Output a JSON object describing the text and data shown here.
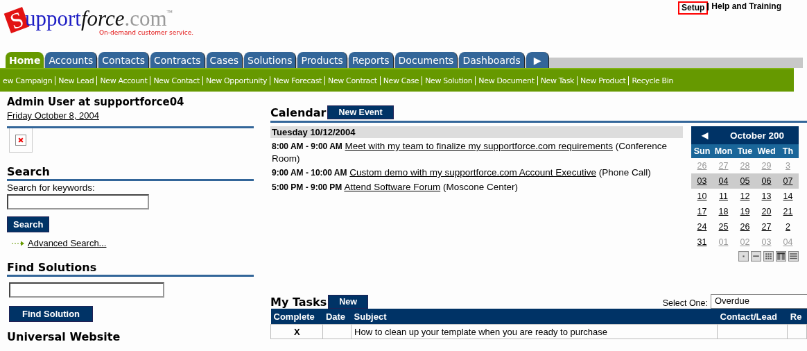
{
  "logo": {
    "initial": "S",
    "part1": "upport",
    "part2": "force",
    "part3": ".com",
    "tm": "™",
    "tagline": "On-demand customer service."
  },
  "top_links": [
    {
      "label": "Setup",
      "highlighted": true
    },
    {
      "label": "Help and Training",
      "highlighted": false
    }
  ],
  "tabs": [
    {
      "label": "Home",
      "selected": true,
      "kind": "text"
    },
    {
      "label": "Accounts",
      "selected": false,
      "kind": "text"
    },
    {
      "label": "Contacts",
      "selected": false,
      "kind": "text"
    },
    {
      "label": "Contracts",
      "selected": false,
      "kind": "text"
    },
    {
      "label": "Cases",
      "selected": false,
      "kind": "text"
    },
    {
      "label": "Solutions",
      "selected": false,
      "kind": "text"
    },
    {
      "label": "Products",
      "selected": false,
      "kind": "text"
    },
    {
      "label": "Reports",
      "selected": false,
      "kind": "text"
    },
    {
      "label": "Documents",
      "selected": false,
      "kind": "text"
    },
    {
      "label": "Dashboards",
      "selected": false,
      "kind": "text"
    },
    {
      "label": "▶",
      "selected": false,
      "kind": "more"
    }
  ],
  "quick_links": [
    "ew Campaign",
    "New Lead",
    "New Account",
    "New Contact",
    "New Opportunity",
    "New Forecast",
    "New Contract",
    "New Case",
    "New Solution",
    "New Document",
    "New Task",
    "New Product",
    "Recycle Bin"
  ],
  "user": {
    "title": "Admin User at supportforce04",
    "date": "Friday October 8, 2004"
  },
  "sidebar": {
    "search": {
      "heading": "Search",
      "label": "Search for keywords:",
      "button": "Search",
      "advanced": "Advanced Search..."
    },
    "solutions": {
      "heading": "Find Solutions",
      "button": "Find Solution"
    },
    "next_heading": "Universal Website"
  },
  "calendar": {
    "title": "Calendar",
    "button": "New Event",
    "day": "Tuesday 10/12/2004",
    "events": [
      {
        "time": "8:00 AM - 9:00 AM",
        "subject": "Meet with my team to finalize my supportforce.com requirements",
        "location": "(Conference Room)"
      },
      {
        "time": "9:00 AM - 10:00 AM",
        "subject": "Custom demo with my supportforce.com Account Executive",
        "location": "(Phone Call)"
      },
      {
        "time": "5:00 PM - 9:00 PM",
        "subject": "Attend Software Forum",
        "location": "(Moscone Center)"
      }
    ],
    "month": {
      "prev": "◀",
      "title": "October 200",
      "weekdays": [
        "Sun",
        "Mon",
        "Tue",
        "Wed",
        "Th"
      ],
      "weeks": [
        {
          "selected": false,
          "days": [
            {
              "text": "26",
              "muted": true
            },
            {
              "text": "27",
              "muted": true
            },
            {
              "text": "28",
              "muted": true
            },
            {
              "text": "29",
              "muted": true
            },
            {
              "text": "3",
              "muted": true
            }
          ]
        },
        {
          "selected": true,
          "days": [
            {
              "text": "03",
              "muted": false
            },
            {
              "text": "04",
              "muted": false
            },
            {
              "text": "05",
              "muted": false
            },
            {
              "text": "06",
              "muted": false
            },
            {
              "text": "07",
              "muted": false
            }
          ]
        },
        {
          "selected": false,
          "days": [
            {
              "text": "10",
              "muted": false
            },
            {
              "text": "11",
              "muted": false
            },
            {
              "text": "12",
              "muted": false
            },
            {
              "text": "13",
              "muted": false
            },
            {
              "text": "14",
              "muted": false
            }
          ]
        },
        {
          "selected": false,
          "days": [
            {
              "text": "17",
              "muted": false
            },
            {
              "text": "18",
              "muted": false
            },
            {
              "text": "19",
              "muted": false
            },
            {
              "text": "20",
              "muted": false
            },
            {
              "text": "21",
              "muted": false
            }
          ]
        },
        {
          "selected": false,
          "days": [
            {
              "text": "24",
              "muted": false
            },
            {
              "text": "25",
              "muted": false
            },
            {
              "text": "26",
              "muted": false
            },
            {
              "text": "27",
              "muted": false
            },
            {
              "text": "2",
              "muted": false
            }
          ]
        },
        {
          "selected": false,
          "days": [
            {
              "text": "31",
              "muted": false
            },
            {
              "text": "01",
              "muted": true
            },
            {
              "text": "02",
              "muted": true
            },
            {
              "text": "03",
              "muted": true
            },
            {
              "text": "04",
              "muted": true
            }
          ]
        }
      ],
      "views": [
        {
          "kind": "day"
        },
        {
          "kind": "week"
        },
        {
          "kind": "month"
        },
        {
          "kind": "columns"
        },
        {
          "kind": "list"
        }
      ]
    }
  },
  "tasks": {
    "title": "My Tasks",
    "button": "New",
    "select_label": "Select One:",
    "select_value": "Overdue",
    "columns": [
      "Complete",
      "Date",
      "Subject",
      "Contact/Lead",
      "Re"
    ],
    "rows": [
      [
        "X",
        "",
        "How to clean up your template when you are ready to purchase",
        "",
        ""
      ]
    ]
  }
}
